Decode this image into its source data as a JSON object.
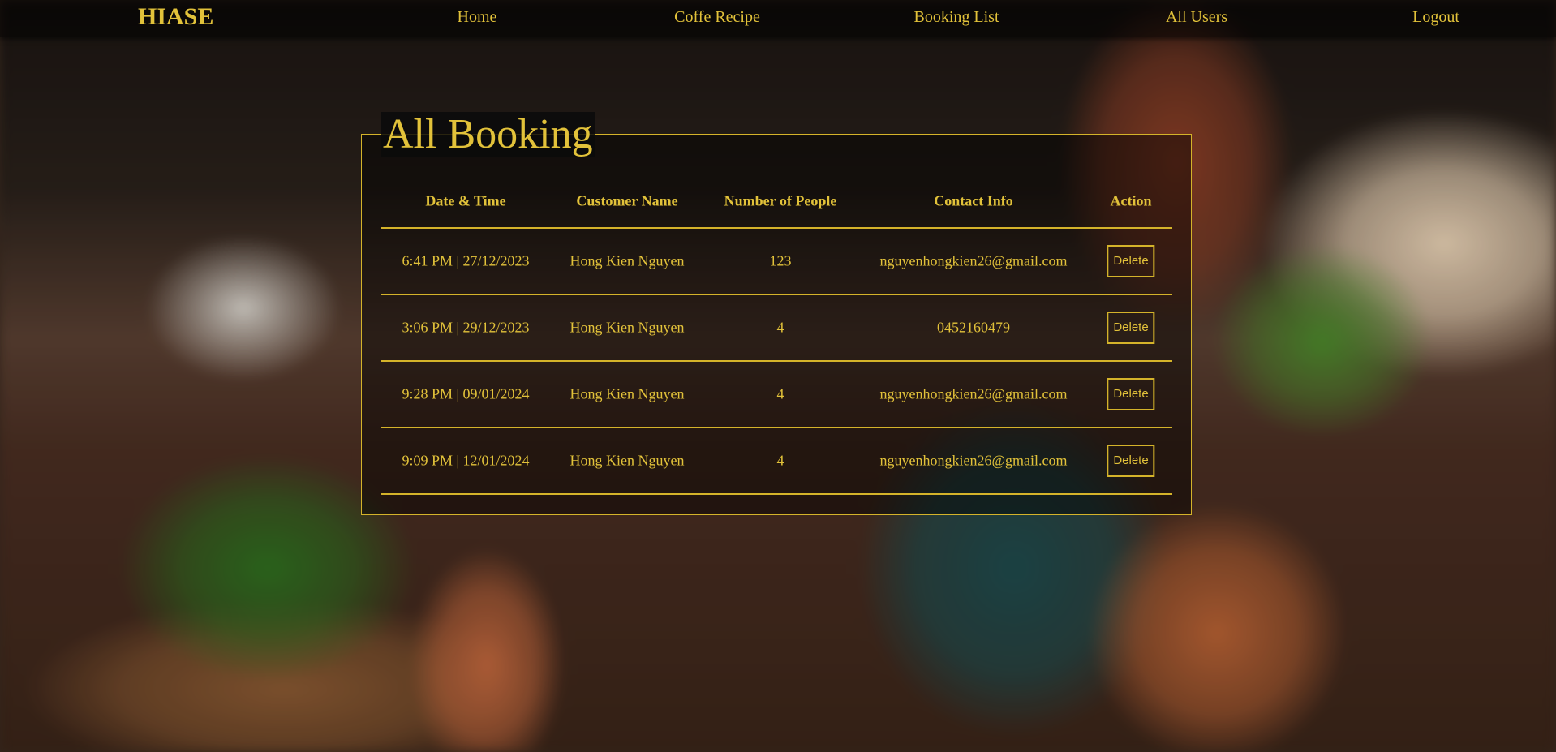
{
  "navbar": {
    "brand": "HIASE",
    "links": [
      {
        "label": "Home"
      },
      {
        "label": "Coffe Recipe"
      },
      {
        "label": "Booking List"
      },
      {
        "label": "All Users"
      },
      {
        "label": "Logout"
      }
    ]
  },
  "main": {
    "title": "All Booking",
    "columns": [
      "Date & Time",
      "Customer Name",
      "Number of People",
      "Contact Info",
      "Action"
    ],
    "rows": [
      {
        "datetime": "6:41 PM | 27/12/2023",
        "customer": "Hong Kien Nguyen",
        "people": "123",
        "contact": "nguyenhongkien26@gmail.com",
        "action": "Delete"
      },
      {
        "datetime": "3:06 PM | 29/12/2023",
        "customer": "Hong Kien Nguyen",
        "people": "4",
        "contact": "0452160479",
        "action": "Delete"
      },
      {
        "datetime": "9:28 PM | 09/01/2024",
        "customer": "Hong Kien Nguyen",
        "people": "4",
        "contact": "nguyenhongkien26@gmail.com",
        "action": "Delete"
      },
      {
        "datetime": "9:09 PM | 12/01/2024",
        "customer": "Hong Kien Nguyen",
        "people": "4",
        "contact": "nguyenhongkien26@gmail.com",
        "action": "Delete"
      }
    ]
  },
  "colors": {
    "accent": "#e2c23a",
    "border": "#d4b32a"
  }
}
